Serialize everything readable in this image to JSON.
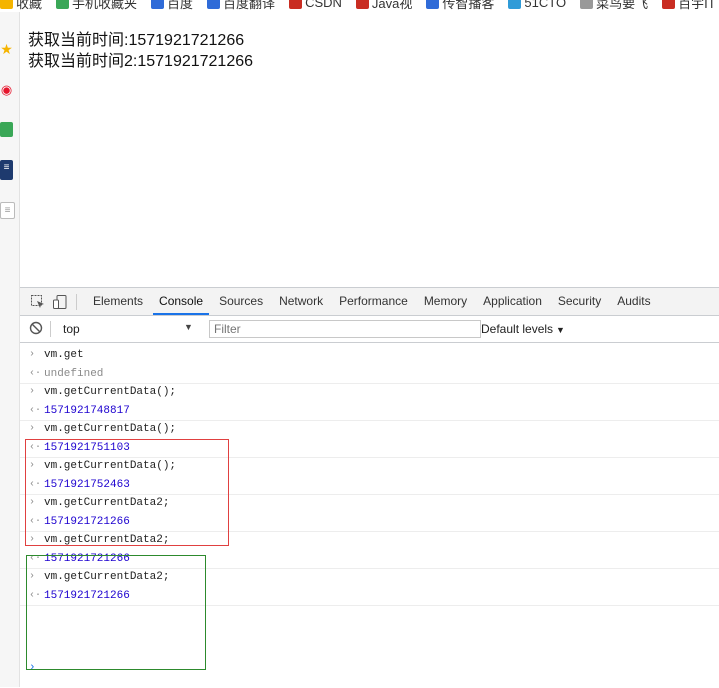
{
  "bookmarks": [
    {
      "label": "收藏",
      "color": "#f5b400"
    },
    {
      "label": "手机收藏夹",
      "color": "#3aa757"
    },
    {
      "label": "百度",
      "color": "#2f6bd8"
    },
    {
      "label": "百度翻译",
      "color": "#2f6bd8"
    },
    {
      "label": "CSDN",
      "color": "#c92d22"
    },
    {
      "label": "Java视",
      "color": "#c92d22"
    },
    {
      "label": "传智播客",
      "color": "#2f6bd8"
    },
    {
      "label": "51CTO",
      "color": "#2f9bd8"
    },
    {
      "label": "菜鸟要飞",
      "color": "#999999"
    },
    {
      "label": "百宇IT",
      "color": "#c92d22"
    }
  ],
  "page": {
    "line1": "获取当前时间:1571921721266",
    "line2": "获取当前时间2:1571921721266"
  },
  "devtools": {
    "tabs": [
      "Elements",
      "Console",
      "Sources",
      "Network",
      "Performance",
      "Memory",
      "Application",
      "Security",
      "Audits"
    ],
    "active_tab": "Console",
    "context": "top",
    "filter_placeholder": "Filter",
    "levels": "Default levels"
  },
  "console": [
    {
      "kind": "input",
      "text": "vm.get"
    },
    {
      "kind": "undef",
      "text": "undefined"
    },
    {
      "kind": "input",
      "text": "vm.getCurrentData();"
    },
    {
      "kind": "num",
      "text": "1571921748817"
    },
    {
      "kind": "input",
      "text": "vm.getCurrentData();"
    },
    {
      "kind": "num",
      "text": "1571921751103"
    },
    {
      "kind": "input",
      "text": "vm.getCurrentData();"
    },
    {
      "kind": "num",
      "text": "1571921752463"
    },
    {
      "kind": "input",
      "text": "vm.getCurrentData2;"
    },
    {
      "kind": "num",
      "text": "1571921721266"
    },
    {
      "kind": "input",
      "text": "vm.getCurrentData2;"
    },
    {
      "kind": "num",
      "text": "1571921721266"
    },
    {
      "kind": "input",
      "text": "vm.getCurrentData2;"
    },
    {
      "kind": "num",
      "text": "1571921721266"
    }
  ]
}
